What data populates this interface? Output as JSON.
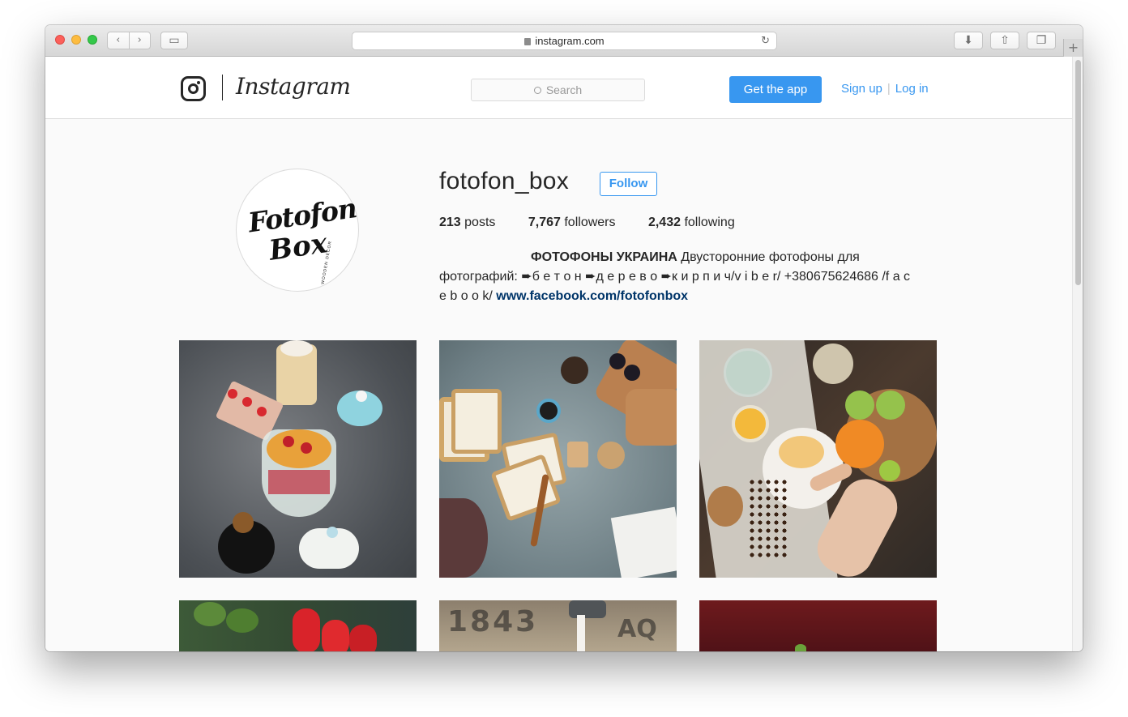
{
  "browser": {
    "url": "instagram.com",
    "new_tab_label": "+"
  },
  "header": {
    "wordmark": "Instagram",
    "search_placeholder": "Search",
    "get_app_label": "Get the app",
    "signup_label": "Sign up",
    "separator": "|",
    "login_label": "Log in"
  },
  "profile": {
    "username": "fotofon_box",
    "follow_label": "Follow",
    "avatar_text_1": "Fotofon",
    "avatar_text_2": "Box",
    "avatar_text_3": "WOODEN DECOR",
    "posts_count": "213",
    "posts_label": "posts",
    "followers_count": "7,767",
    "followers_label": "followers",
    "following_count": "2,432",
    "following_label": "following",
    "bio_bold": "ФОТОФОНЫ УКРАИНА",
    "bio_text_1": " Двусторонние фотофоны для фотографий:       ➨б е т о н       ➨д е р е в о       ➨к и р п и ч/v i b e r/ +380675624686 /f a c e b o o k/ ",
    "bio_link": "www.facebook.com/fotofonbox"
  },
  "colors": {
    "accent": "#3897f0",
    "link_dark": "#003569",
    "text": "#262626",
    "border": "#dbdbdb"
  },
  "icons": {
    "back": "chevron-left-icon",
    "forward": "chevron-right-icon",
    "sidebar": "sidebar-icon",
    "download": "download-icon",
    "share": "share-icon",
    "tabs": "tabs-icon",
    "reload": "reload-icon",
    "lock": "lock-icon",
    "camera": "instagram-camera-icon",
    "search": "search-icon"
  }
}
